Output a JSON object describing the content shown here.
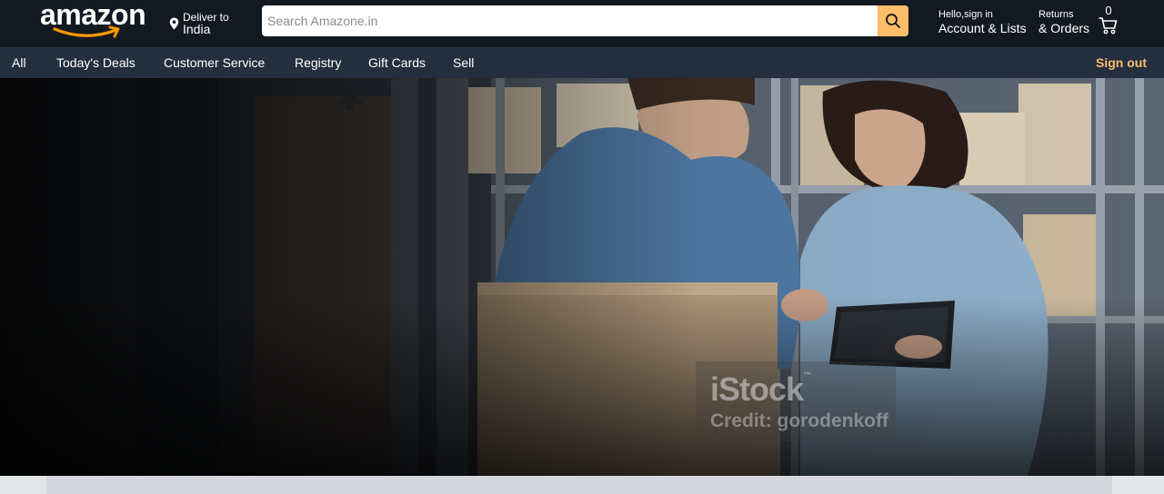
{
  "header": {
    "logo_text": "amazon",
    "deliver_label": "Deliver to",
    "deliver_location": "India",
    "search": {
      "placeholder": "Search Amazone.in",
      "value": ""
    },
    "account_greeting": "Hello,sign in",
    "account_label": "Account & Lists",
    "returns_label": "Returns",
    "orders_label": "& Orders",
    "cart_count": "0"
  },
  "nav": {
    "items": [
      {
        "label": "All"
      },
      {
        "label": "Today's Deals"
      },
      {
        "label": "Customer Service"
      },
      {
        "label": "Registry"
      },
      {
        "label": "Gift Cards"
      },
      {
        "label": "Sell"
      }
    ],
    "sign_out": "Sign out"
  },
  "hero": {
    "watermark_logo": "iStock",
    "watermark_tm": "™",
    "watermark_credit": "Credit: gorodenkoff"
  },
  "colors": {
    "header_bg": "#131921",
    "nav_bg": "#232f3e",
    "accent": "#febd69",
    "logo_arrow": "#ff9900"
  },
  "icons": [
    "location-pin-icon",
    "search-icon",
    "cart-icon",
    "logo-smile-arrow"
  ]
}
